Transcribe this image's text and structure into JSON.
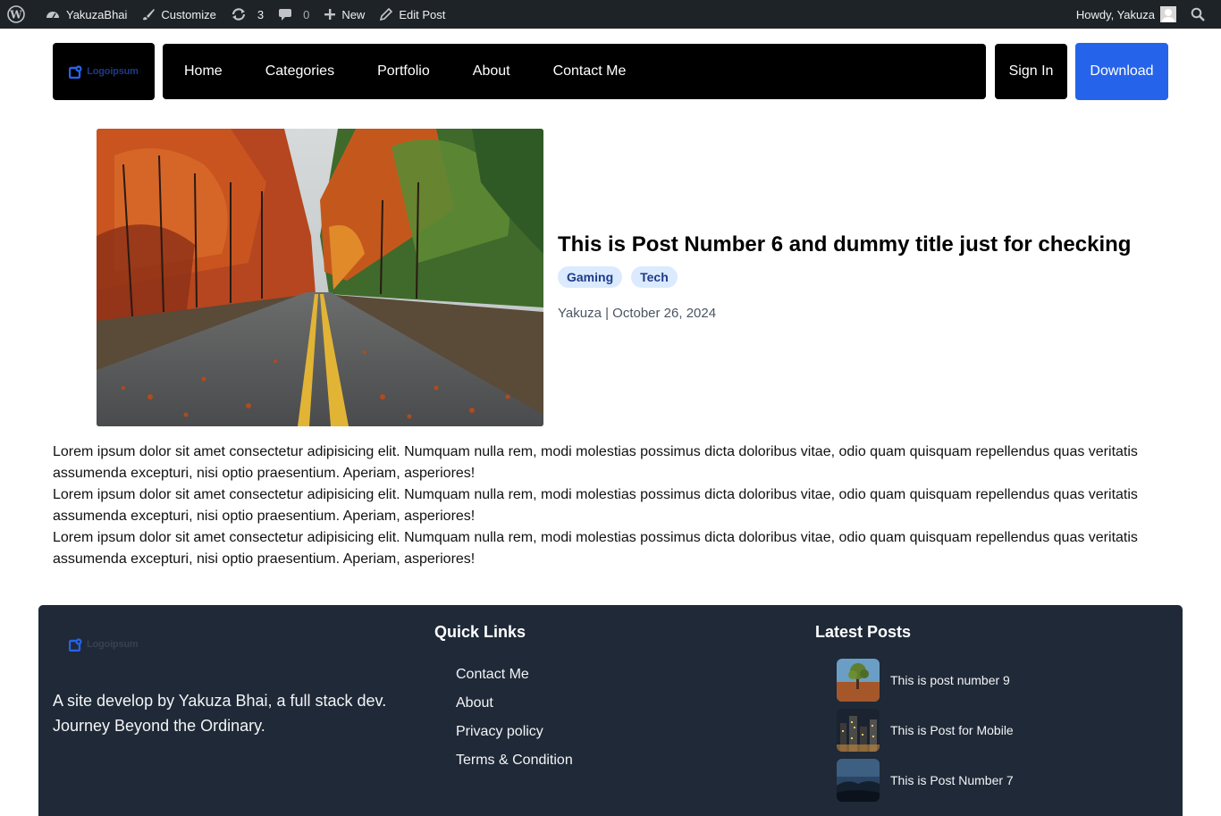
{
  "admin_bar": {
    "site_name": "YakuzaBhai",
    "customize": "Customize",
    "updates_count": "3",
    "comments_count": "0",
    "new": "New",
    "edit_post": "Edit Post",
    "howdy": "Howdy, Yakuza"
  },
  "header": {
    "logo_text": "Logoipsum",
    "nav": [
      "Home",
      "Categories",
      "Portfolio",
      "About",
      "Contact Me"
    ],
    "signin": "Sign In",
    "download": "Download"
  },
  "post": {
    "title": "This is Post Number 6 and dummy title just for checking",
    "tags": [
      "Gaming",
      "Tech"
    ],
    "meta": "Yakuza | October 26, 2024",
    "paragraphs": [
      "Lorem ipsum dolor sit amet consectetur adipisicing elit. Numquam nulla rem, modi molestias possimus dicta doloribus vitae, odio quam quisquam repellendus quas veritatis assumenda excepturi, nisi optio praesentium. Aperiam, asperiores!",
      "Lorem ipsum dolor sit amet consectetur adipisicing elit. Numquam nulla rem, modi molestias possimus dicta doloribus vitae, odio quam quisquam repellendus quas veritatis assumenda excepturi, nisi optio praesentium. Aperiam, asperiores!",
      "Lorem ipsum dolor sit amet consectetur adipisicing elit. Numquam nulla rem, modi molestias possimus dicta doloribus vitae, odio quam quisquam repellendus quas veritatis assumenda excepturi, nisi optio praesentium. Aperiam, asperiores!"
    ]
  },
  "footer": {
    "logo_text": "Logoipsum",
    "description": "A site develop by Yakuza Bhai, a full stack dev. Journey Beyond the Ordinary.",
    "quick_links_heading": "Quick Links",
    "quick_links": [
      "Contact Me",
      "About",
      "Privacy policy",
      "Terms & Condition"
    ],
    "latest_posts_heading": "Latest Posts",
    "latest_posts": [
      "This is post number 9",
      "This is Post for Mobile",
      "This is Post Number 7"
    ]
  },
  "colors": {
    "admin_bar": "#1d2327",
    "nav_bg": "#000000",
    "download": "#2563eb",
    "tag_bg": "#dbeafe",
    "footer_bg": "#1f2937"
  }
}
